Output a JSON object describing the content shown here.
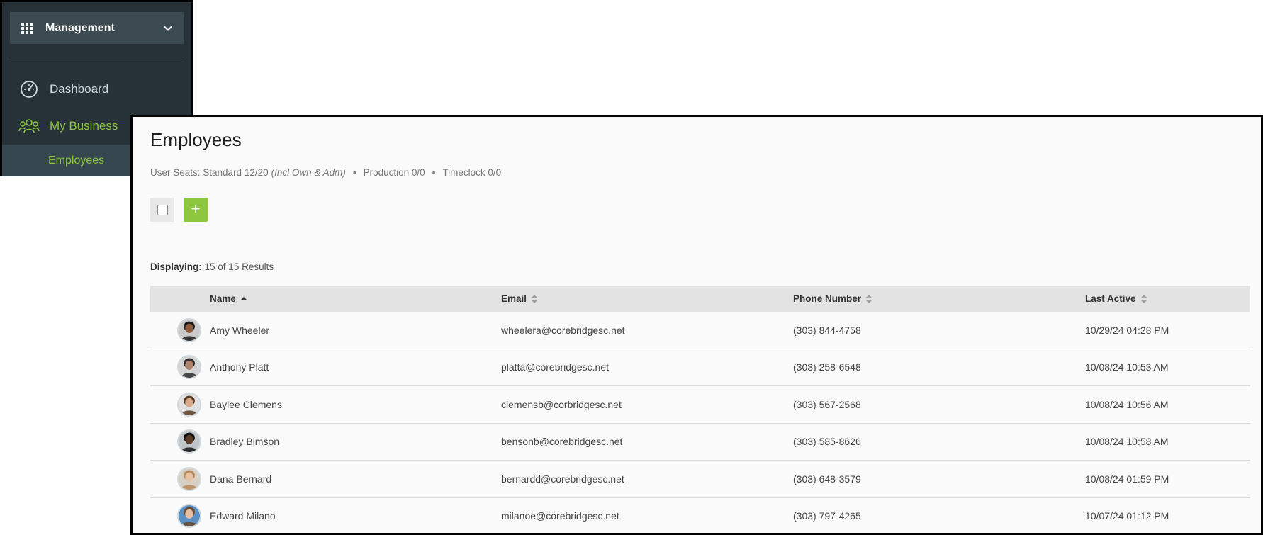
{
  "sidebar": {
    "menu_label": "Management",
    "items": [
      {
        "label": "Dashboard"
      },
      {
        "label": "My Business"
      },
      {
        "label": "Employees"
      }
    ]
  },
  "page": {
    "title": "Employees",
    "seats_prefix": "User Seats: Standard 12/20",
    "seats_note": "(Incl Own & Adm)",
    "production": "Production 0/0",
    "timeclock": "Timeclock 0/0",
    "bullet": "•",
    "add_label": "+",
    "displaying_label": "Displaying:",
    "displaying_value": "15 of 15 Results"
  },
  "table": {
    "columns": [
      "Name",
      "Email",
      "Phone Number",
      "Last Active"
    ],
    "rows": [
      {
        "name": "Amy Wheeler",
        "email": "wheelera@corebridgesc.net",
        "phone": "(303) 844-4758",
        "last": "10/29/24 04:28 PM",
        "skin": "#8d5a3b",
        "hair": "#1b1b1b",
        "bg": "#c9c9c9"
      },
      {
        "name": "Anthony Platt",
        "email": "platta@corebridgesc.net",
        "phone": "(303) 258-6548",
        "last": "10/08/24 10:53 AM",
        "skin": "#b0836b",
        "hair": "#2a2a2a",
        "bg": "#d4d4d4"
      },
      {
        "name": "Baylee Clemens",
        "email": "clemensb@corbridgesc.net",
        "phone": "(303) 567-2568",
        "last": "10/08/24 10:56 AM",
        "skin": "#d9a98c",
        "hair": "#5a3a24",
        "bg": "#e0e0e0"
      },
      {
        "name": "Bradley Bimson",
        "email": "bensonb@corebridgesc.net",
        "phone": "(303) 585-8626",
        "last": "10/08/24 10:58 AM",
        "skin": "#5b3a26",
        "hair": "#111111",
        "bg": "#bfc5c9"
      },
      {
        "name": "Dana Bernard",
        "email": "bernardd@corebridgesc.net",
        "phone": "(303) 648-3579",
        "last": "10/08/24 01:59 PM",
        "skin": "#e7c3a6",
        "hair": "#b88a5a",
        "bg": "#d8d0c4"
      },
      {
        "name": "Edward Milano",
        "email": "milanoe@corebridgesc.net",
        "phone": "(303) 797-4265",
        "last": "10/07/24 01:12 PM",
        "skin": "#e6bfa5",
        "hair": "#6b4a2e",
        "bg": "#5c8fc4"
      }
    ]
  }
}
